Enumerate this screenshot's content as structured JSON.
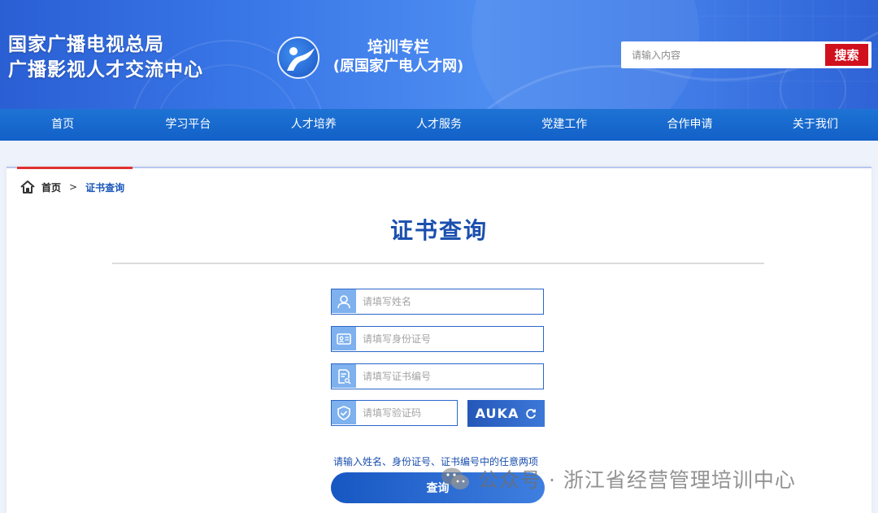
{
  "header": {
    "org_line1": "国家广播电视总局",
    "org_line2": "广播影视人才交流中心",
    "site_title_line1": "培训专栏",
    "site_title_line2": "(原国家广电人才网)",
    "search_placeholder": "请输入内容",
    "search_button": "搜索"
  },
  "nav": {
    "items": [
      "首页",
      "学习平台",
      "人才培养",
      "人才服务",
      "党建工作",
      "合作申请",
      "关于我们"
    ]
  },
  "breadcrumb": {
    "home": "首页",
    "separator": ">",
    "current": "证书查询"
  },
  "form": {
    "title": "证书查询",
    "name_placeholder": "请填写姓名",
    "id_placeholder": "请填写身份证号",
    "cert_placeholder": "请填写证书编号",
    "captcha_placeholder": "请填写验证码",
    "captcha_text": "AUKA",
    "hint": "请输入姓名、身份证号、证书编号中的任意两项",
    "submit": "查询"
  },
  "watermark": {
    "text": "公众号 · 浙江省经营管理培训中心"
  },
  "colors": {
    "primary": "#1a4fae",
    "nav": "#1260c8",
    "search_button": "#d1101e",
    "accent_bar": "#e03131"
  }
}
